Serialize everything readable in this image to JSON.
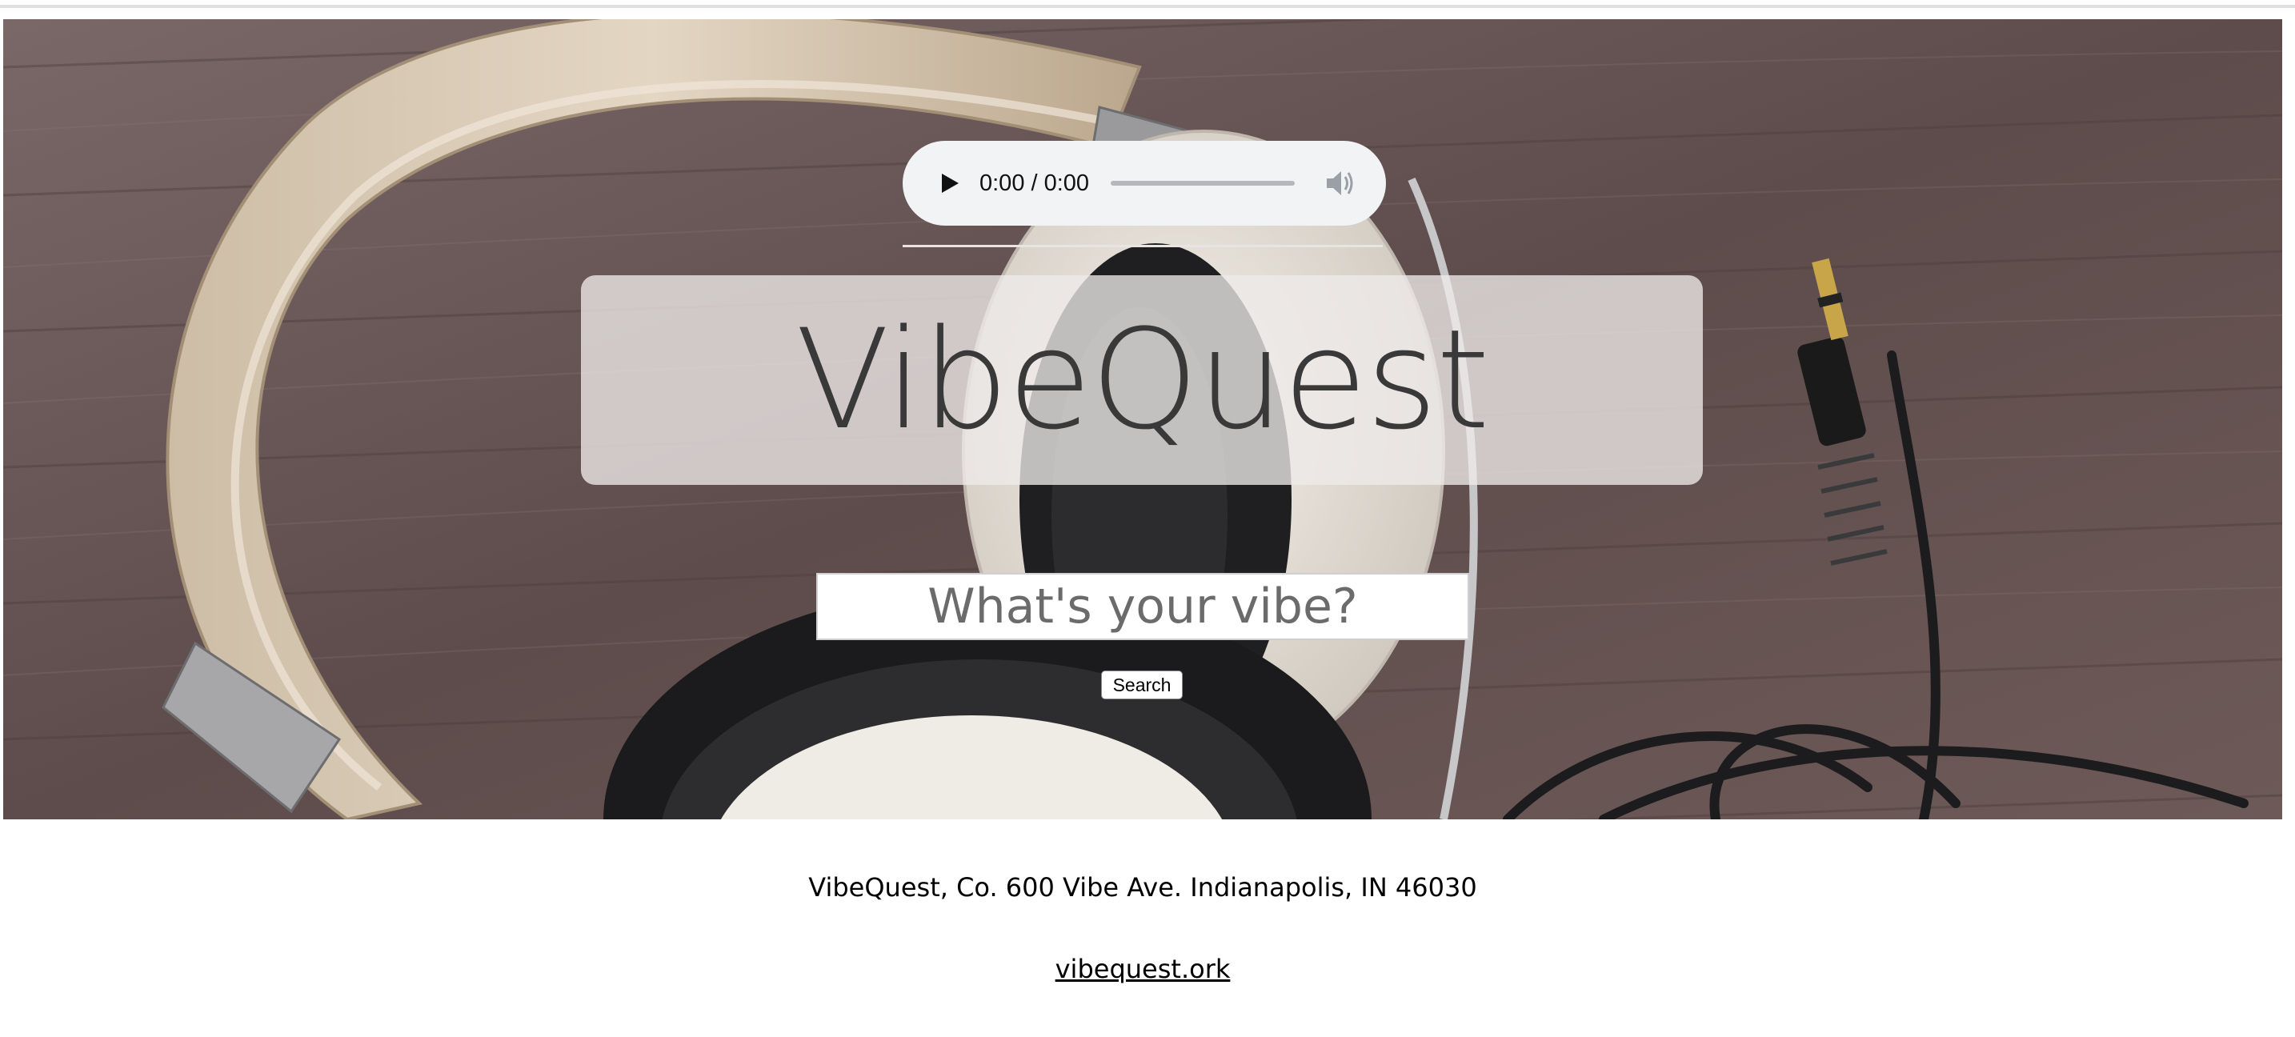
{
  "audio_player": {
    "time": "0:00 / 0:00",
    "progress_fraction": 0,
    "play_icon": "play-icon",
    "volume_icon": "volume-icon"
  },
  "hero": {
    "title": "VibeQuest",
    "search": {
      "placeholder": "What's your vibe?",
      "value": ""
    },
    "search_button_label": "Search"
  },
  "footer": {
    "address": "VibeQuest, Co. 600 Vibe Ave. Indianapolis, IN 46030",
    "link_text": "vibequest.ork"
  },
  "colors": {
    "wood": "#5f4f4e",
    "player_bg": "#f1f3f4",
    "title_panel": "#eeeae9",
    "title_text": "#3a3939"
  }
}
